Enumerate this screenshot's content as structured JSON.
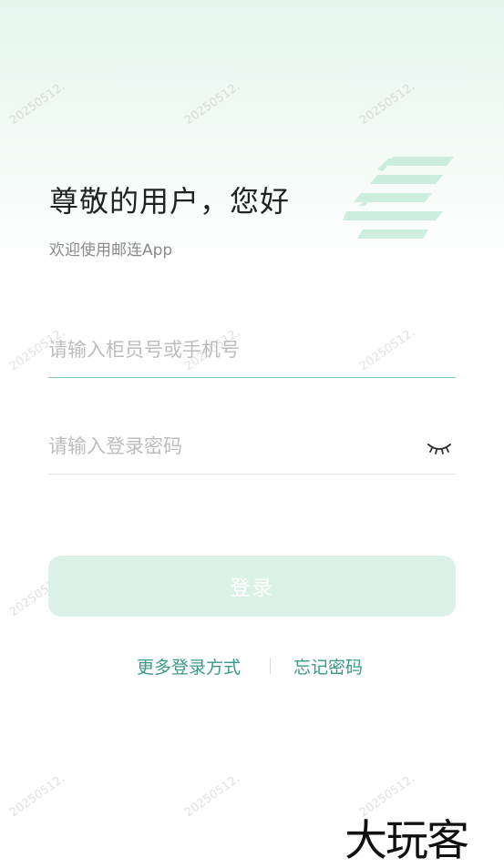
{
  "watermark_text": "20250512.",
  "header": {
    "greeting": "尊敬的用户，您好",
    "subtitle": "欢迎使用邮连App"
  },
  "form": {
    "account_placeholder": "请输入柜员号或手机号",
    "account_value": "",
    "password_placeholder": "请输入登录密码",
    "password_value": "",
    "password_toggle_icon": "closed-eye-icon"
  },
  "actions": {
    "login_label": "登录",
    "more_login_label": "更多登录方式",
    "forgot_password_label": "忘记密码"
  },
  "brand_text": "大玩客",
  "colors": {
    "accent": "#3a9a86",
    "button_bg": "#dcf1e7",
    "active_underline": "#7fc8c0",
    "logo_green": "#bfe8d6"
  }
}
